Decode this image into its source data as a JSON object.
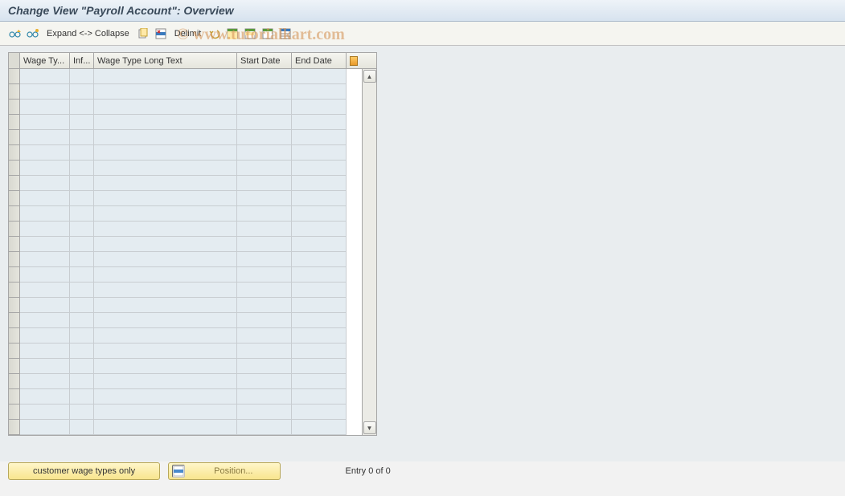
{
  "title": "Change View \"Payroll Account\": Overview",
  "toolbar": {
    "expand_collapse": "Expand <-> Collapse",
    "delimit": "Delimit"
  },
  "table": {
    "columns": {
      "wage_type": "Wage Ty...",
      "inf": "Inf...",
      "long_text": "Wage Type Long Text",
      "start_date": "Start Date",
      "end_date": "End Date"
    },
    "row_count": 24,
    "rows": []
  },
  "buttons": {
    "customer_wage_types": "customer wage types only",
    "position": "Position..."
  },
  "status": {
    "entry": "Entry 0 of 0"
  },
  "watermark": "© www.tutorialkart.com"
}
